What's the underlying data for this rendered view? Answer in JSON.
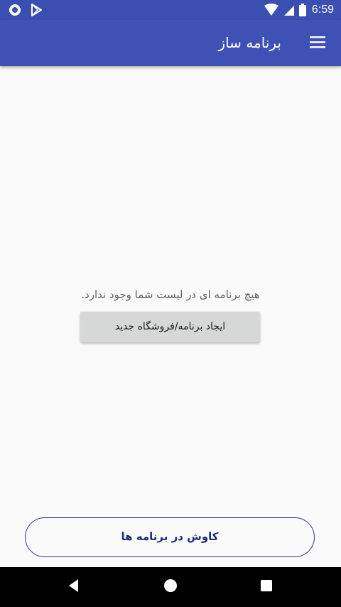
{
  "status_bar": {
    "time": "6:59",
    "left_icons": [
      "notification-circle-icon",
      "play-store-icon"
    ],
    "right_icons": [
      "wifi-icon",
      "cellular-signal-icon",
      "battery-icon"
    ],
    "background": "#3A4FB0"
  },
  "app_bar": {
    "title": "برنامه ساز",
    "menu_icon": "hamburger-menu-icon",
    "background": "#3F51B5"
  },
  "main": {
    "empty_message": "هیچ برنامه ای در لیست شما وجود ندارد.",
    "create_button_label": "ایجاد برنامه/فروشگاه جدید"
  },
  "footer": {
    "explore_button_label": "کاوش در برنامه ها",
    "accent_color": "#1F2A7A"
  },
  "nav_bar": {
    "buttons": [
      "back-icon",
      "home-icon",
      "recents-icon"
    ]
  }
}
